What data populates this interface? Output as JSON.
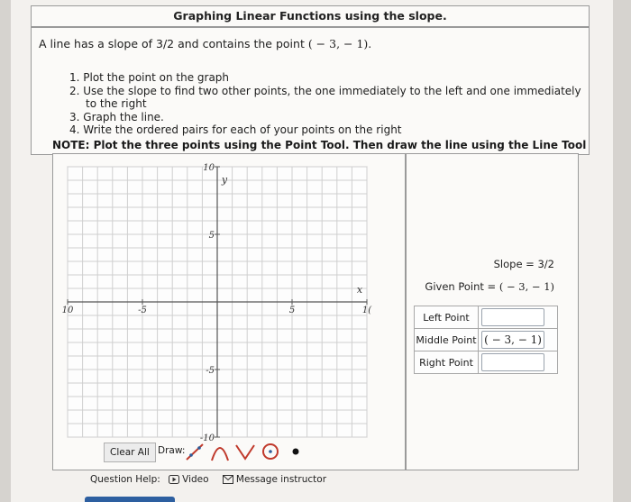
{
  "title": "Graphing Linear Functions using the slope.",
  "problem": {
    "statement_prefix": "A line has a slope of 3/2 and contains the point",
    "point": "( − 3, − 1).",
    "steps": [
      "1. Plot the point on the graph",
      "2. Use the slope to find two other points, the one immediately to the left and one immediately to the right",
      "3. Graph the line.",
      "4. Write the ordered pairs for each of your points on the right"
    ]
  },
  "note": "NOTE: Plot the three points using the Point Tool. Then draw the line using the Line Tool",
  "graph": {
    "x_label": "x",
    "y_label": "y",
    "x_ticks": [
      {
        "value": -10,
        "label": "10"
      },
      {
        "value": -5,
        "label": "-5"
      },
      {
        "value": 5,
        "label": "5"
      },
      {
        "value": 10,
        "label": "1("
      }
    ],
    "y_ticks": [
      {
        "value": 10,
        "label": "10"
      },
      {
        "value": 5,
        "label": "5"
      },
      {
        "value": -5,
        "label": "-5"
      },
      {
        "value": -10,
        "label": "-10"
      }
    ],
    "x_range": [
      -10,
      10
    ],
    "y_range": [
      -10,
      10
    ]
  },
  "side": {
    "slope": "Slope = 3/2",
    "given_label": "Given Point =",
    "given_value": "( − 3, − 1)",
    "rows": [
      {
        "label": "Left Point",
        "value": ""
      },
      {
        "label": "Middle Point",
        "value": "( − 3, − 1)"
      },
      {
        "label": "Right Point",
        "value": ""
      }
    ]
  },
  "toolbar": {
    "clear_label": "Clear All",
    "draw_label": "Draw:",
    "tools": [
      "line-tool-icon",
      "parabola-tool-icon",
      "absolute-value-tool-icon",
      "circle-tool-icon",
      "point-tool-icon"
    ]
  },
  "help": {
    "label": "Question Help:",
    "video": "Video",
    "message": "Message instructor"
  },
  "colors": {
    "grid": "#cfcfcf",
    "axis": "#555555",
    "tool_red": "#c0392b",
    "tool_blue": "#2c5c9a"
  }
}
